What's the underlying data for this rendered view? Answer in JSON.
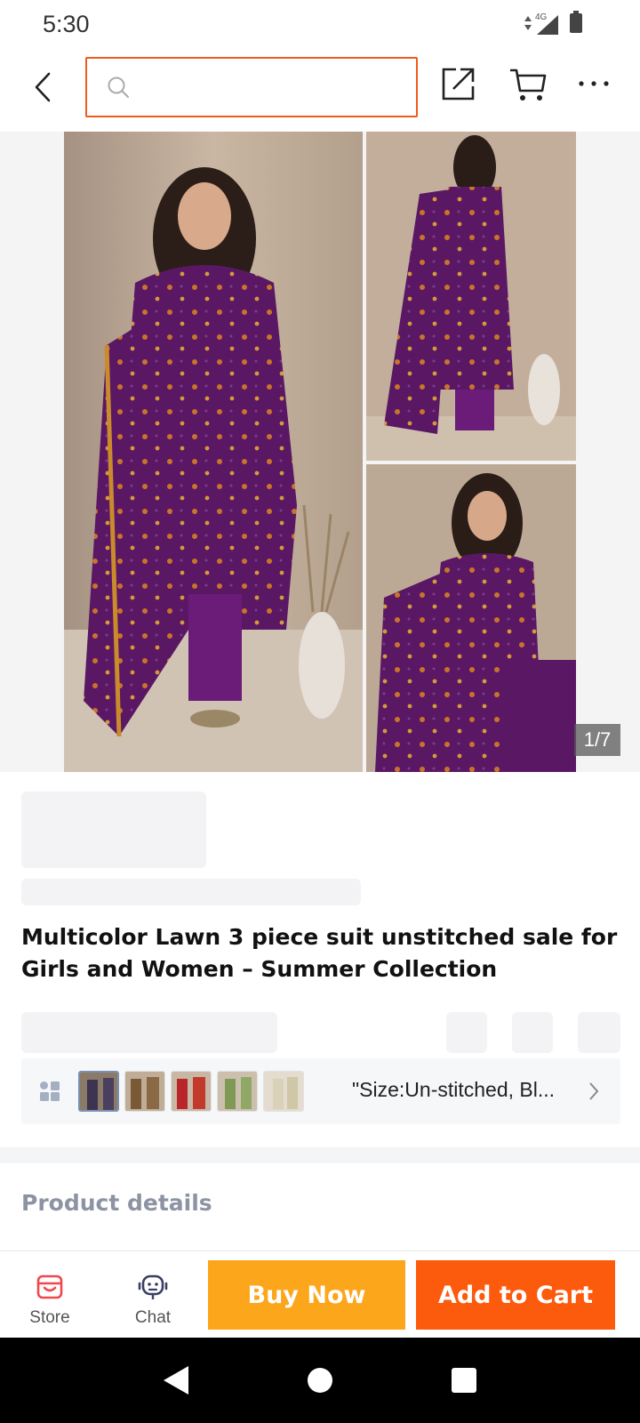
{
  "status_bar": {
    "time": "5:30",
    "network": "4G"
  },
  "search": {
    "placeholder": "",
    "value": ""
  },
  "gallery": {
    "counter": "1/7",
    "image_count": 7,
    "current_index": 1
  },
  "product": {
    "title": "Multicolor Lawn 3 piece suit unstitched sale for Girls and Women – Summer Collection"
  },
  "variants": {
    "selected_text": "\"Size:Un-stitched, Bl...",
    "thumbnail_count": 5
  },
  "sections": {
    "product_details": "Product details"
  },
  "bottom_bar": {
    "store_label": "Store",
    "chat_label": "Chat",
    "buy_now_label": "Buy Now",
    "add_to_cart_label": "Add to Cart"
  },
  "colors": {
    "accent": "#f05a1a",
    "buy_now": "#fca61c",
    "add_to_cart": "#fc5a0c",
    "garment": "#5a1764"
  },
  "icons": [
    "back-icon",
    "search-icon",
    "share-icon",
    "cart-icon",
    "more-icon",
    "variant-grid-icon",
    "chevron-right-icon",
    "store-icon",
    "chat-icon",
    "nav-back-icon",
    "nav-home-icon",
    "nav-recents-icon"
  ]
}
